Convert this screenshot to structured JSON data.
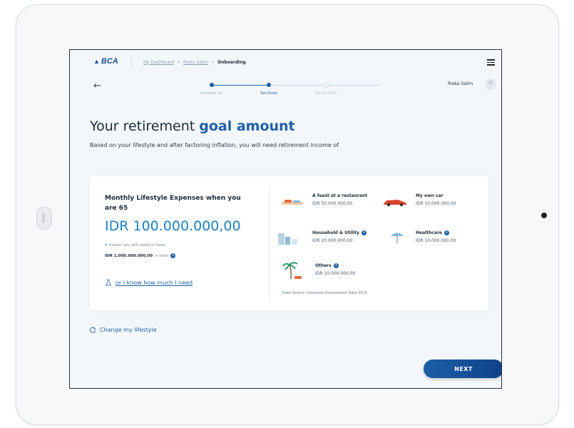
{
  "header": {
    "logo_text": "BCA",
    "breadcrumb": [
      "My Dashboard",
      "Rieka Salim",
      "Onboarding"
    ],
    "menu_icon": "hamburger-icon",
    "user_name": "Rieka Salim"
  },
  "stepper": {
    "steps": [
      "Knowing You",
      "Set Goals",
      "Set Portfolio"
    ],
    "active_index": 1
  },
  "title": {
    "plain": "Your retirement ",
    "accent": "goal amount"
  },
  "subtitle": "Based on your lifestyle and after factoring inflation, you will need retirement income of",
  "summary": {
    "label": "Monthly Lifestyle Expenses when you are 65",
    "amount": "IDR 100.000.000,00",
    "note": "It means you will need to have",
    "total_value": "IDR 1.000.000.000,00",
    "total_suffix": "in total",
    "know_link": "or I know how much I need"
  },
  "expenses": [
    {
      "name": "A feast at a restaurant",
      "value": "IDR 50.000.000,00",
      "icon": "restaurant-icon",
      "info": false
    },
    {
      "name": "My own car",
      "value": "IDR 10.000.000,00",
      "icon": "car-icon",
      "info": false
    },
    {
      "name": "Household & Utility",
      "value": "IDR 20.000.000,00",
      "icon": "household-icon",
      "info": true
    },
    {
      "name": "Healthcare",
      "value": "IDR 10.000.000,00",
      "icon": "healthcare-icon",
      "info": true
    },
    {
      "name": "Others",
      "value": "IDR 10.000.000,00",
      "icon": "others-icon",
      "info": true
    }
  ],
  "data_source": "Data Source: Indonesia Government Data 2016",
  "change_link": "Change my lifestyle",
  "next_label": "NEXT",
  "colors": {
    "brand": "#1d5fa8",
    "amount": "#1d7fc1",
    "muted": "#c9d6e4"
  }
}
